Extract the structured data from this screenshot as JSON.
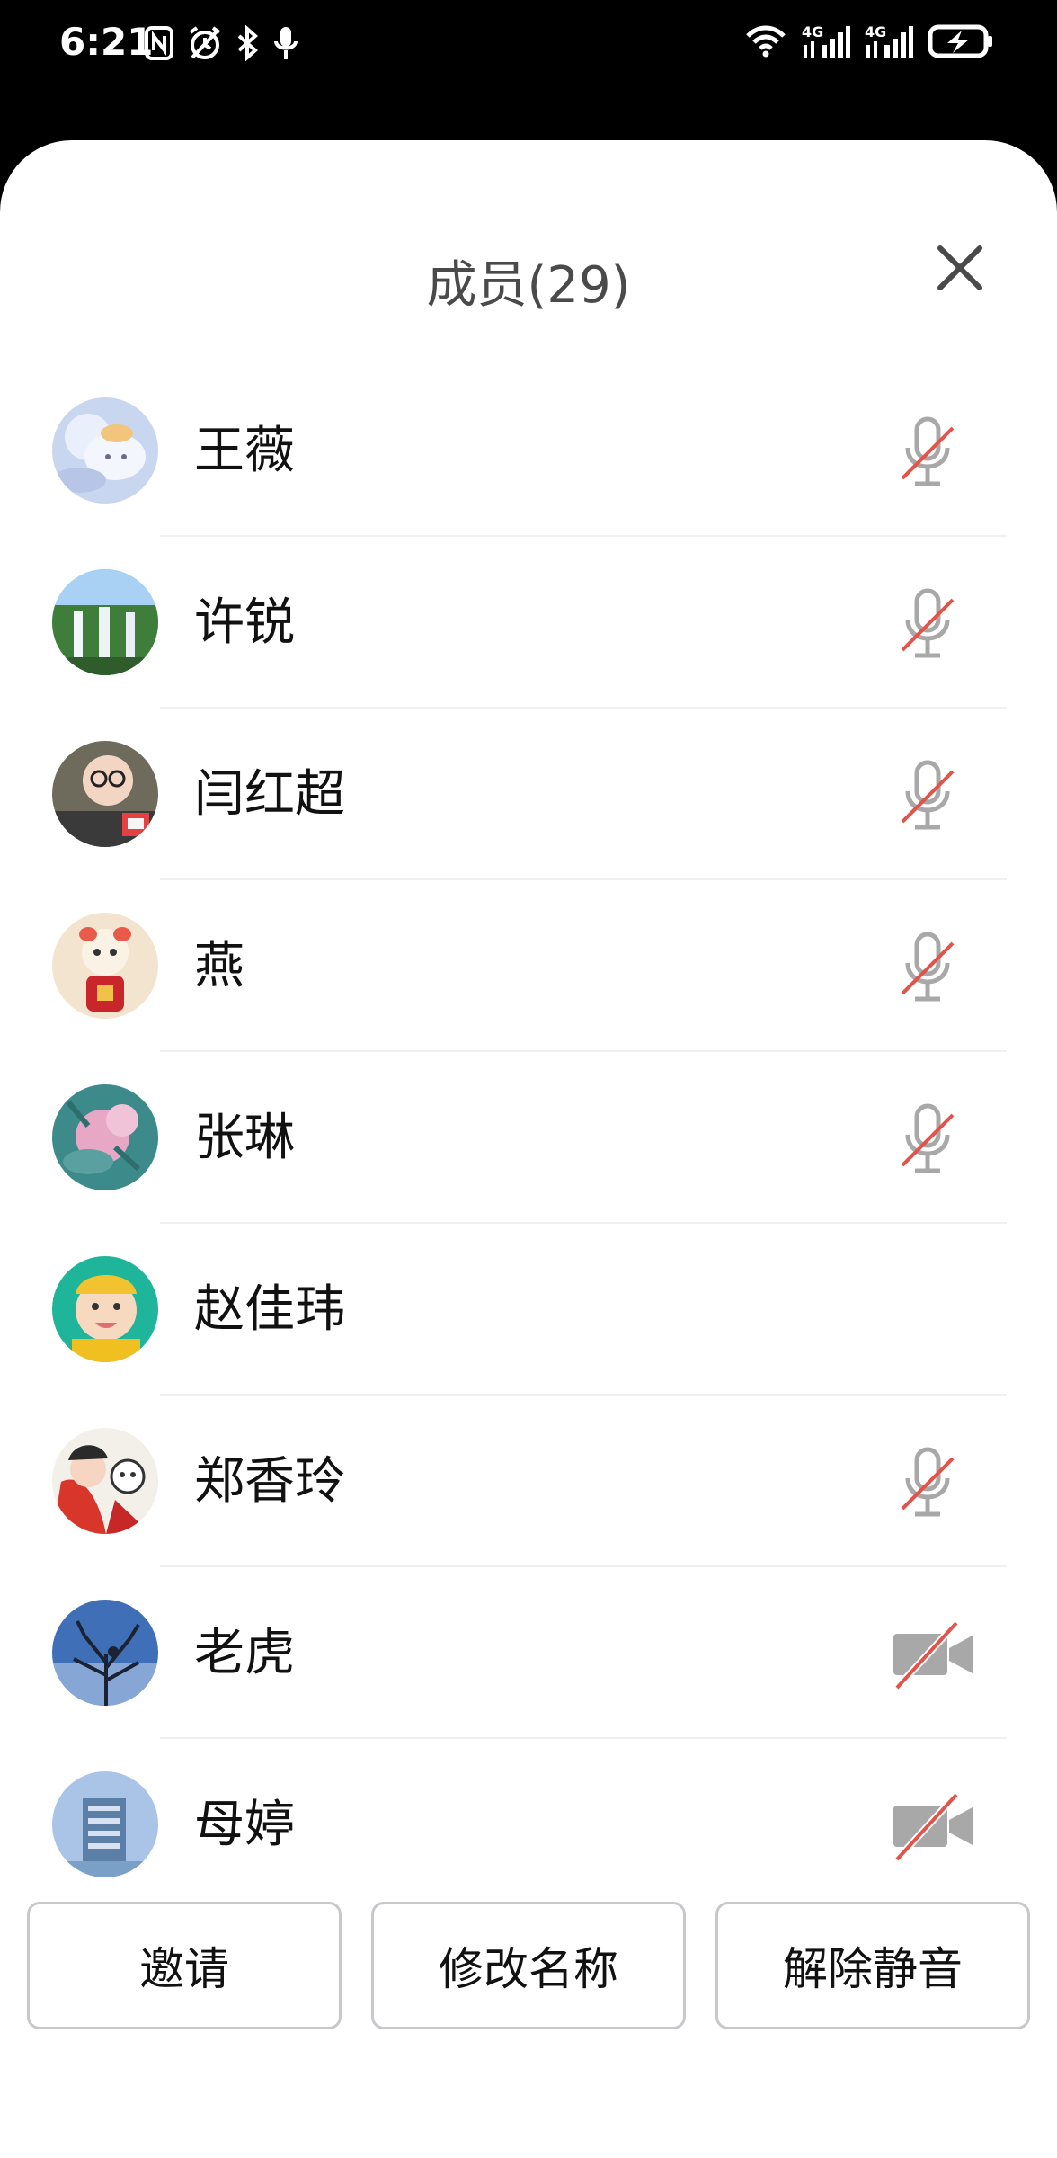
{
  "status_bar": {
    "time": "6:21",
    "left_icons": [
      "nfc-icon",
      "alarm-icon",
      "bluetooth-icon",
      "microphone-icon"
    ],
    "right_icons": [
      "wifi-icon",
      "signal-4g-icon",
      "signal-4g-icon",
      "battery-charging-icon"
    ],
    "network_label_1": "4G",
    "network_label_2": "4G"
  },
  "sheet": {
    "title": "成员(29)"
  },
  "members": [
    {
      "name": "王薇",
      "status_icon": "mic-muted-icon"
    },
    {
      "name": "许锐",
      "status_icon": "mic-muted-icon"
    },
    {
      "name": "闫红超",
      "status_icon": "mic-muted-icon"
    },
    {
      "name": "燕",
      "status_icon": "mic-muted-icon"
    },
    {
      "name": "张琳",
      "status_icon": "mic-muted-icon"
    },
    {
      "name": "赵佳玮",
      "status_icon": ""
    },
    {
      "name": "郑香玲",
      "status_icon": "mic-muted-icon"
    },
    {
      "name": "老虎",
      "status_icon": "video-off-icon"
    },
    {
      "name": "母婷",
      "status_icon": "video-off-icon"
    }
  ],
  "actions": {
    "invite": "邀请",
    "rename": "修改名称",
    "unmute": "解除静音"
  },
  "colors": {
    "muted_slash": "#e2534a",
    "icon_gray": "#a8a8a8",
    "button_border": "#c8c8cc"
  }
}
